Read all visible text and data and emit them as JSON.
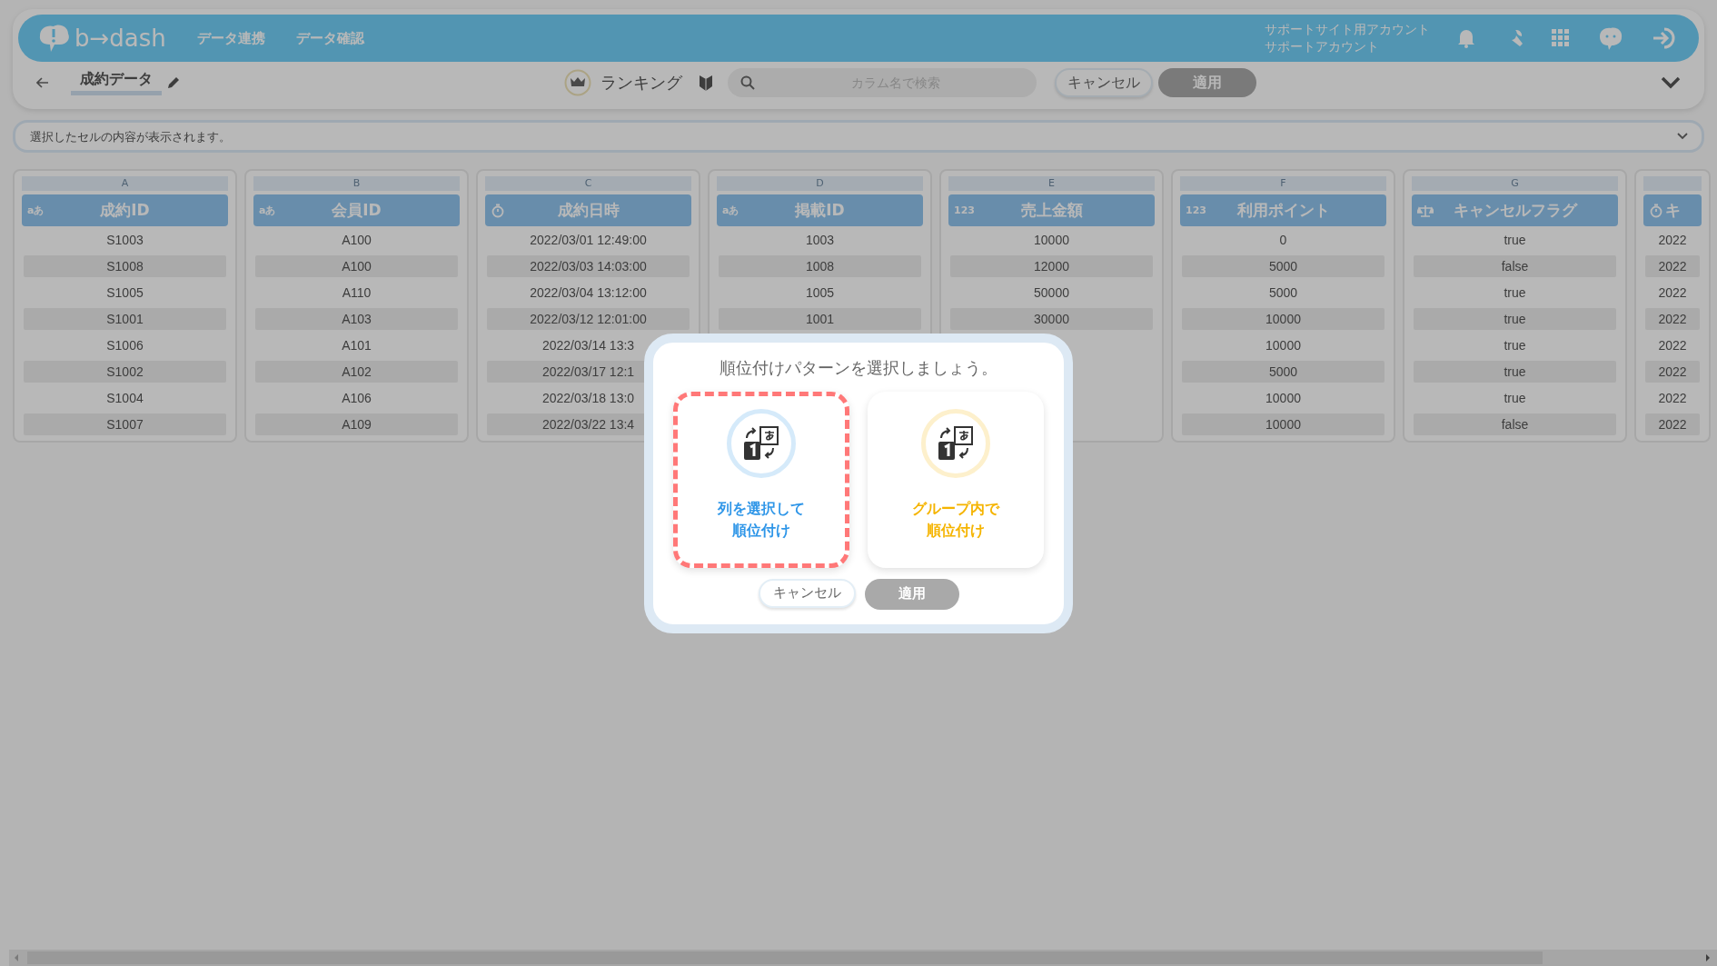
{
  "header": {
    "logo": "b→dash",
    "nav": [
      "データ連携",
      "データ確認"
    ],
    "account": [
      "サポートサイト用アカウント",
      "サポートアカウント"
    ]
  },
  "toolbar": {
    "title": "成約データ",
    "mode": "ランキング",
    "search": {
      "placeholder": "カラム名で検索"
    },
    "cancel": "キャンセル",
    "apply": {
      "label": "適用",
      "disabled": true
    }
  },
  "cell_bar": {
    "placeholder": "選択したセルの内容が表示されます。"
  },
  "columns": [
    {
      "letter": "A",
      "kind": "text",
      "type_label": "aあ",
      "name": "成約ID",
      "cells": [
        "S1003",
        "S1008",
        "S1005",
        "S1001",
        "S1006",
        "S1002",
        "S1004",
        "S1007"
      ]
    },
    {
      "letter": "B",
      "kind": "text",
      "type_label": "aあ",
      "name": "会員ID",
      "cells": [
        "A100",
        "A100",
        "A110",
        "A103",
        "A101",
        "A102",
        "A106",
        "A109"
      ]
    },
    {
      "letter": "C",
      "kind": "datetime",
      "name": "成約日時",
      "cells": [
        "2022/03/01 12:49:00",
        "2022/03/03 14:03:00",
        "2022/03/04 13:12:00",
        "2022/03/12 12:01:00",
        "2022/03/14 13:3",
        "2022/03/17 12:1",
        "2022/03/18 13:0",
        "2022/03/22 13:4"
      ]
    },
    {
      "letter": "D",
      "kind": "text",
      "type_label": "aあ",
      "name": "掲載ID",
      "cells": [
        "1003",
        "1008",
        "1005",
        "1001",
        null,
        null,
        null,
        null
      ]
    },
    {
      "letter": "E",
      "kind": "number",
      "type_label": "123",
      "name": "売上金額",
      "cells": [
        "10000",
        "12000",
        "50000",
        "30000",
        null,
        null,
        null,
        null
      ]
    },
    {
      "letter": "F",
      "kind": "number",
      "type_label": "123",
      "name": "利用ポイント",
      "cells": [
        "0",
        "5000",
        "5000",
        "10000",
        "10000",
        "5000",
        "10000",
        "10000"
      ]
    },
    {
      "letter": "G",
      "kind": "bool",
      "name": "キャンセルフラグ",
      "cells": [
        "true",
        "false",
        "true",
        "true",
        "true",
        "true",
        "true",
        "false"
      ]
    },
    {
      "kind": "datetime",
      "name": "キ",
      "cells": [
        "2022",
        "2022",
        "2022",
        "2022",
        "2022",
        "2022",
        "2022",
        "2022"
      ]
    }
  ],
  "dialog": {
    "title": "順位付けパターンを選択しましょう。",
    "options": [
      {
        "lines": [
          "列を選択して",
          "順位付け"
        ],
        "color": "#2f96e8",
        "selected": true
      },
      {
        "lines": [
          "グループ内で",
          "順位付け"
        ],
        "color": "#f5b400",
        "selected": false
      }
    ],
    "cancel": "キャンセル",
    "apply": {
      "label": "適用",
      "disabled": true
    }
  }
}
